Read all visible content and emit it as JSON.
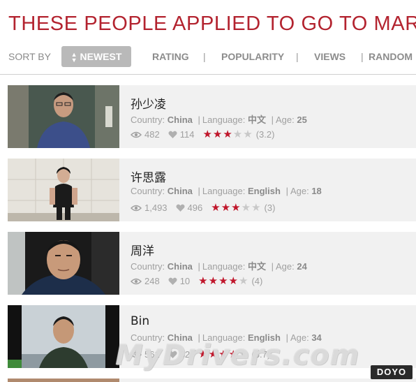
{
  "page": {
    "title": "THESE PEOPLE APPLIED TO GO TO MARS"
  },
  "sort": {
    "label": "SORT BY",
    "newest": "NEWEST",
    "rating": "RATING",
    "popularity": "POPULARITY",
    "views": "VIEWS",
    "random": "RANDOM",
    "separator": "|"
  },
  "labels": {
    "country": "Country:",
    "language": "Language:",
    "age": "Age:",
    "divider": "|"
  },
  "applicants": [
    {
      "name": "孙少凌",
      "country": "China",
      "language": "中文",
      "age": "25",
      "views": "482",
      "likes": "114",
      "rating_text": "(3.2)",
      "stars": 3
    },
    {
      "name": "许思露",
      "country": "China",
      "language": "English",
      "age": "18",
      "views": "1,493",
      "likes": "496",
      "rating_text": "(3)",
      "stars": 3
    },
    {
      "name": "周洋",
      "country": "China",
      "language": "中文",
      "age": "24",
      "views": "248",
      "likes": "10",
      "rating_text": "(4)",
      "stars": 4
    },
    {
      "name": "Bin",
      "country": "China",
      "language": "English",
      "age": "34",
      "views": "561",
      "likes": "32",
      "rating_text": "(3.7)",
      "stars": 4
    }
  ],
  "watermark": {
    "text": "MyDrivers.com"
  },
  "logo": {
    "text": "DOYO"
  },
  "colors": {
    "accent": "#b3232f",
    "star_on": "#c0162b",
    "star_off": "#c8c8c8",
    "card_bg": "#f1f1f1"
  },
  "icons": {
    "views": "eye-icon",
    "likes": "heart-icon",
    "stars": "star-icon",
    "sort": "sort-arrows-icon"
  }
}
